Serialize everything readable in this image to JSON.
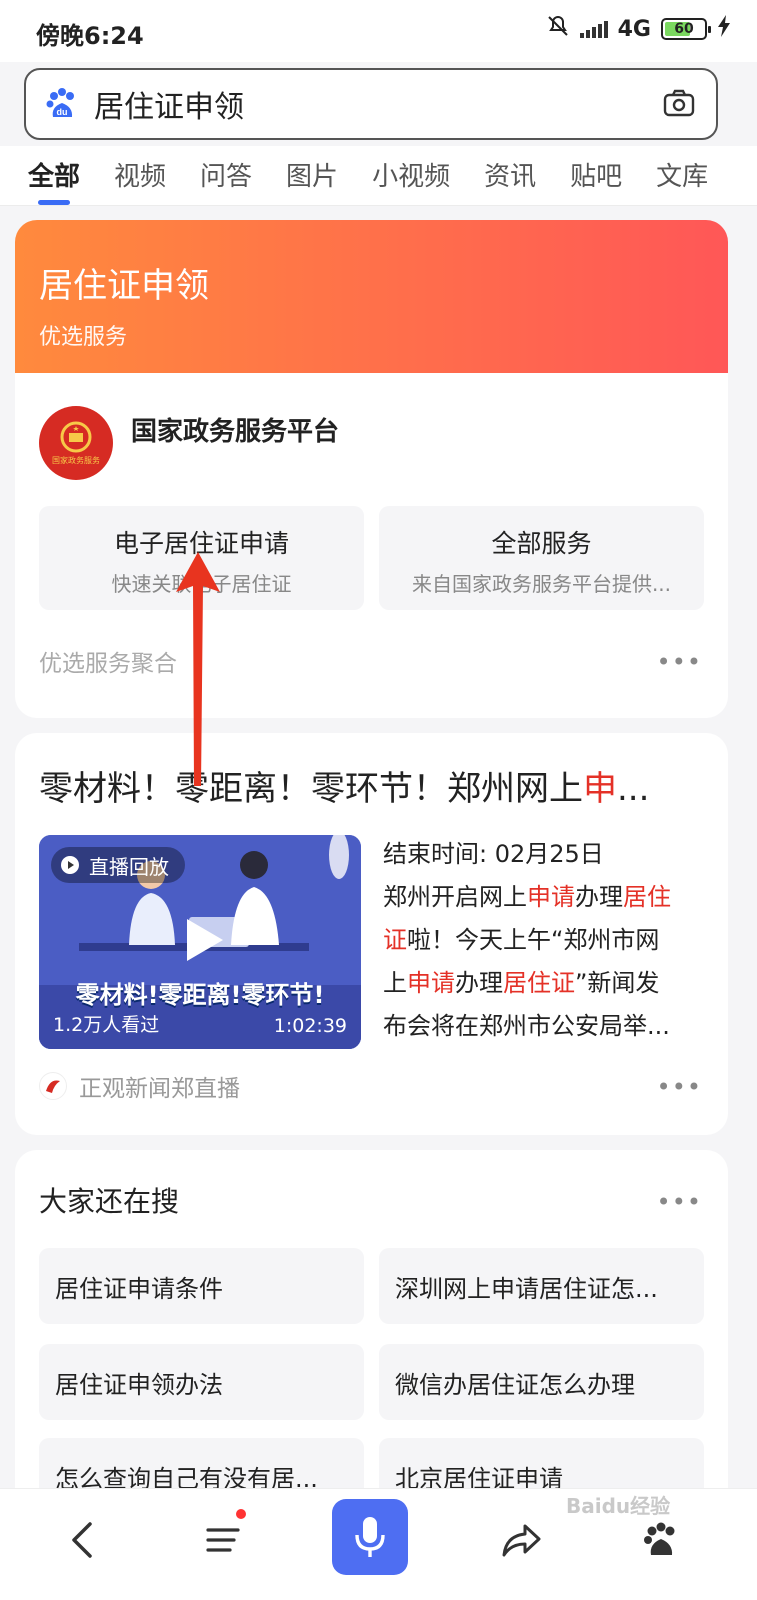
{
  "status_bar": {
    "time": "傍晚6:24",
    "network": "4G",
    "battery": "60"
  },
  "search": {
    "query": "居住证申领"
  },
  "tabs": [
    {
      "label": "全部",
      "active": true
    },
    {
      "label": "视频"
    },
    {
      "label": "问答"
    },
    {
      "label": "图片"
    },
    {
      "label": "小视频"
    },
    {
      "label": "资讯"
    },
    {
      "label": "贴吧"
    },
    {
      "label": "文库"
    }
  ],
  "service_card": {
    "title": "居住证申领",
    "subtitle": "优选服务",
    "provider": "国家政务服务平台",
    "emblem_text": "国家政务服务",
    "services": [
      {
        "title": "电子居住证申请",
        "desc": "快速关联电子居住证"
      },
      {
        "title": "全部服务",
        "desc": "来自国家政务服务平台提供..."
      }
    ],
    "footer": "优选服务聚合",
    "more": "•••"
  },
  "news_card": {
    "title_pre": "零材料！零距离！零环节！郑州网上",
    "title_hl": "申",
    "title_post": "...",
    "video": {
      "tag": "直播回放",
      "banner": "零材料!零距离!零环节!",
      "viewers": "1.2万人看过",
      "duration": "1:02:39"
    },
    "desc": {
      "end_time": "结束时间: 02月25日",
      "l2_a": "郑州开启网上",
      "l2_b": "申请",
      "l2_c": "办理",
      "l2_d": "居住",
      "l3_a": "证",
      "l3_b": "啦！今天上午“郑州市网",
      "l4_a": "上",
      "l4_b": "申请",
      "l4_c": "办理",
      "l4_d": "居住证",
      "l4_e": "”新闻发",
      "l5": "布会将在郑州市公安局举..."
    },
    "source": "正观新闻郑直播",
    "more": "•••"
  },
  "related": {
    "heading": "大家还在搜",
    "more": "•••",
    "items": [
      "居住证申请条件",
      "深圳网上申请居住证怎...",
      "居住证申领办法",
      "微信办居住证怎么办理",
      "怎么查询自己有没有居...",
      "北京居住证申请"
    ]
  },
  "watermark": "Baidu经验",
  "colors": {
    "accent": "#3a6cf5",
    "highlight": "#e43127",
    "hero_start": "#ff8a3d",
    "hero_end": "#ff5757",
    "mic": "#4e6ef2"
  }
}
